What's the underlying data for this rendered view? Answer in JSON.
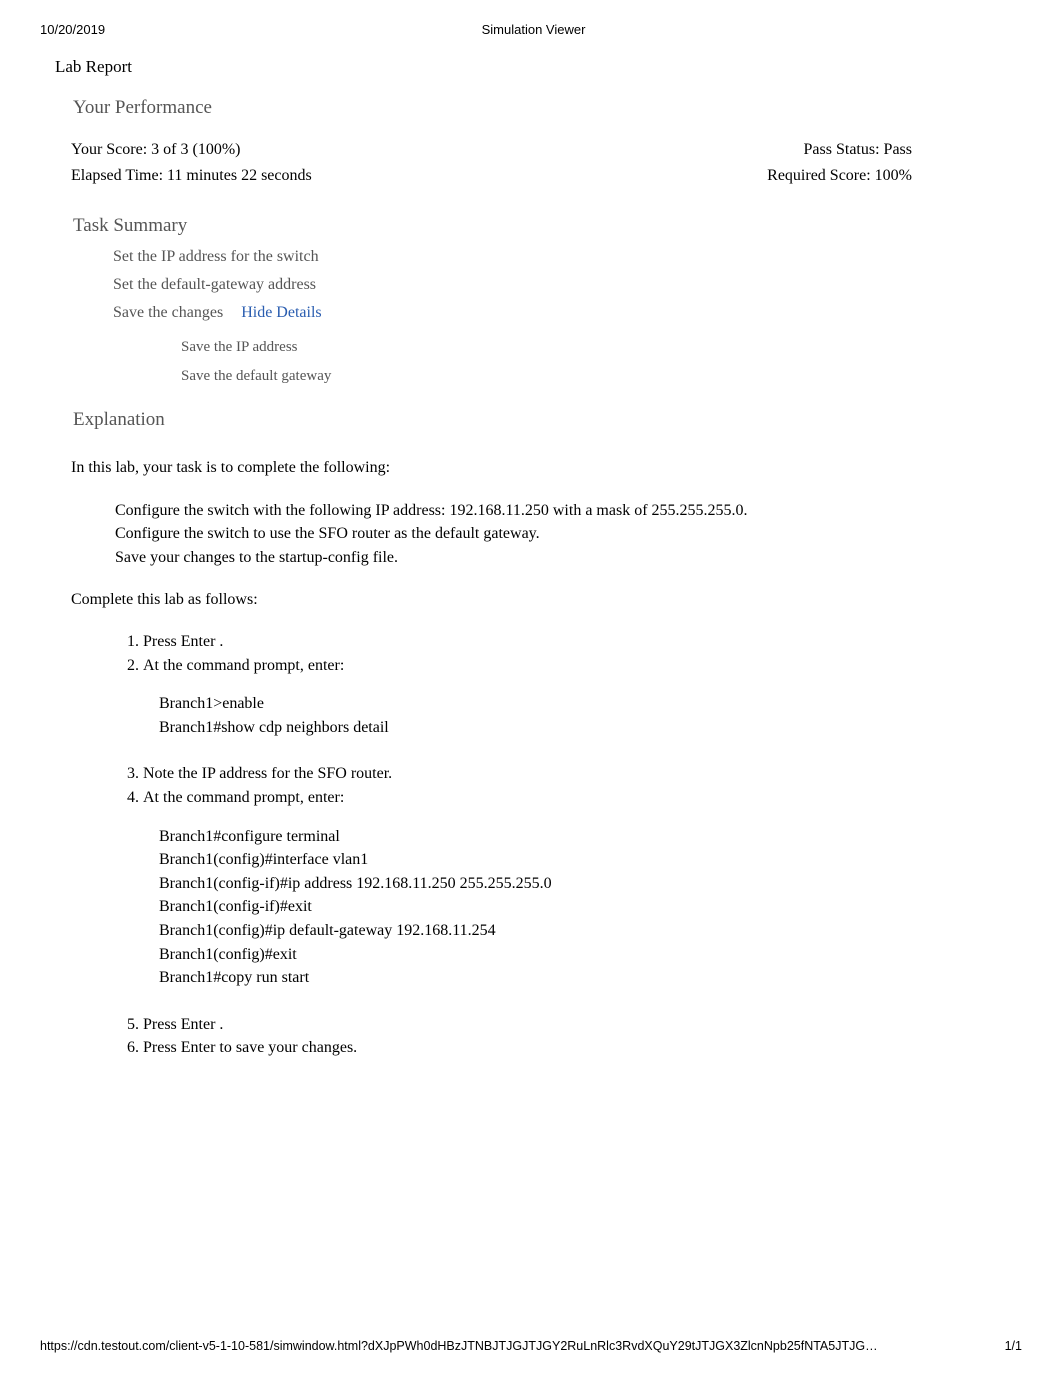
{
  "header": {
    "date": "10/20/2019",
    "title": "Simulation Viewer"
  },
  "report_title": "Lab Report",
  "performance": {
    "heading": "Your Performance",
    "score_line": "Your Score: 3 of 3 (100%)",
    "elapsed_line": "Elapsed Time: 11 minutes 22 seconds",
    "pass_status_line": "Pass Status: Pass",
    "required_score_line": "Required Score: 100%"
  },
  "task_summary": {
    "heading": "Task Summary",
    "tasks": [
      {
        "label": "Set the IP address for the switch"
      },
      {
        "label": "Set the default-gateway address"
      },
      {
        "label": "Save the changes",
        "details_toggle": "Hide Details"
      }
    ],
    "subtasks": [
      {
        "label": "Save the IP address"
      },
      {
        "label": "Save the default gateway"
      }
    ]
  },
  "explanation": {
    "heading": "Explanation",
    "intro": "In this lab, your task is to complete the following:",
    "config_items": [
      "Configure the switch with the following IP address: 192.168.11.250 with a mask of 255.255.255.0.",
      "Configure the switch to use the SFO router as the default gateway.",
      "Save your changes to the startup-config file."
    ],
    "complete_label": "Complete this lab as follows:",
    "steps": [
      "Press Enter .",
      "At the command prompt, enter:"
    ],
    "cmd_block_1": [
      "Branch1>enable",
      "Branch1#show cdp neighbors detail"
    ],
    "steps2": [
      "Note the IP address  for the SFO router.",
      "At the command prompt, enter:"
    ],
    "cmd_block_2": [
      "Branch1#configure terminal",
      "Branch1(config)#interface vlan1",
      "Branch1(config-if)#ip address 192.168.11.250 255.255.255.0",
      "Branch1(config-if)#exit",
      "Branch1(config)#ip default-gateway 192.168.11.254",
      "Branch1(config)#exit",
      "Branch1#copy run start"
    ],
    "steps3": [
      "Press Enter .",
      "Press Enter  to save your changes."
    ]
  },
  "footer": {
    "url": "https://cdn.testout.com/client-v5-1-10-581/simwindow.html?dXJpPWh0dHBzJTNBJTJGJTJGY2RuLnRlc3RvdXQuY29tJTJGX3ZlcnNpb25fNTA5JTJG…",
    "page": "1/1"
  }
}
